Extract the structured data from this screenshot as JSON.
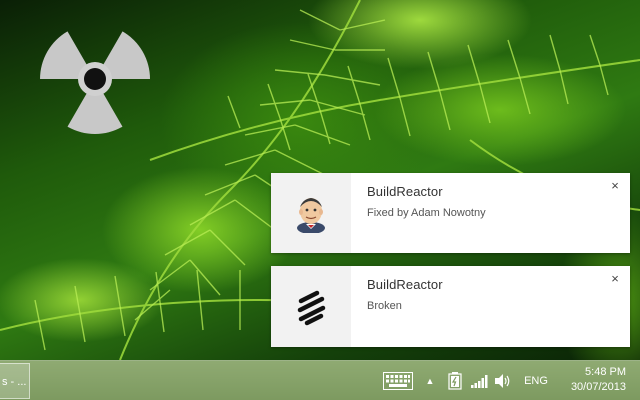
{
  "notifications": [
    {
      "title": "BuildReactor",
      "message": "Fixed by Adam Nowotny",
      "icon": "jenkins-butler-icon",
      "close": "×"
    },
    {
      "title": "BuildReactor",
      "message": "Broken",
      "icon": "buildreactor-stripes-icon",
      "close": "×"
    }
  ],
  "taskbar": {
    "task_button_label": "s - ...",
    "keyboard_icon": "touch-keyboard-icon",
    "chevron": "▲",
    "language": "ENG",
    "time": "5:48 PM",
    "date": "30/07/2013"
  }
}
